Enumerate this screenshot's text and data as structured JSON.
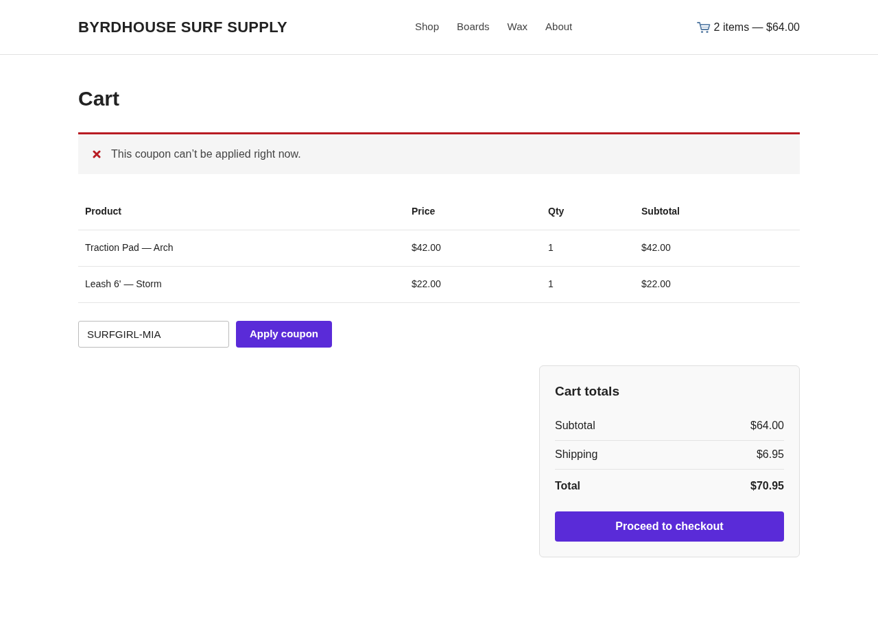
{
  "header": {
    "site_title": "BYRDHOUSE SURF SUPPLY",
    "nav": [
      "Shop",
      "Boards",
      "Wax",
      "About"
    ],
    "cart_summary": "2 items — $64.00"
  },
  "page_title": "Cart",
  "notice": {
    "kind": "error",
    "message": "This coupon can’t be applied right now."
  },
  "table": {
    "columns": [
      "Product",
      "Price",
      "Qty",
      "Subtotal"
    ],
    "rows": [
      [
        "Traction Pad — Arch",
        "$42.00",
        "1",
        "$42.00"
      ],
      [
        "Leash 6' — Storm",
        "$22.00",
        "1",
        "$22.00"
      ]
    ]
  },
  "coupon": {
    "value": "SURFGIRL-MIA",
    "button": "Apply coupon"
  },
  "totals": {
    "title": "Cart totals",
    "rows": [
      {
        "kind": "normal",
        "label": "Subtotal",
        "value": "$64.00"
      },
      {
        "kind": "normal",
        "label": "Shipping",
        "value": "$6.95"
      },
      {
        "kind": "total",
        "label": "Total",
        "value": "$70.95"
      }
    ],
    "checkout_button": "Proceed to checkout"
  }
}
